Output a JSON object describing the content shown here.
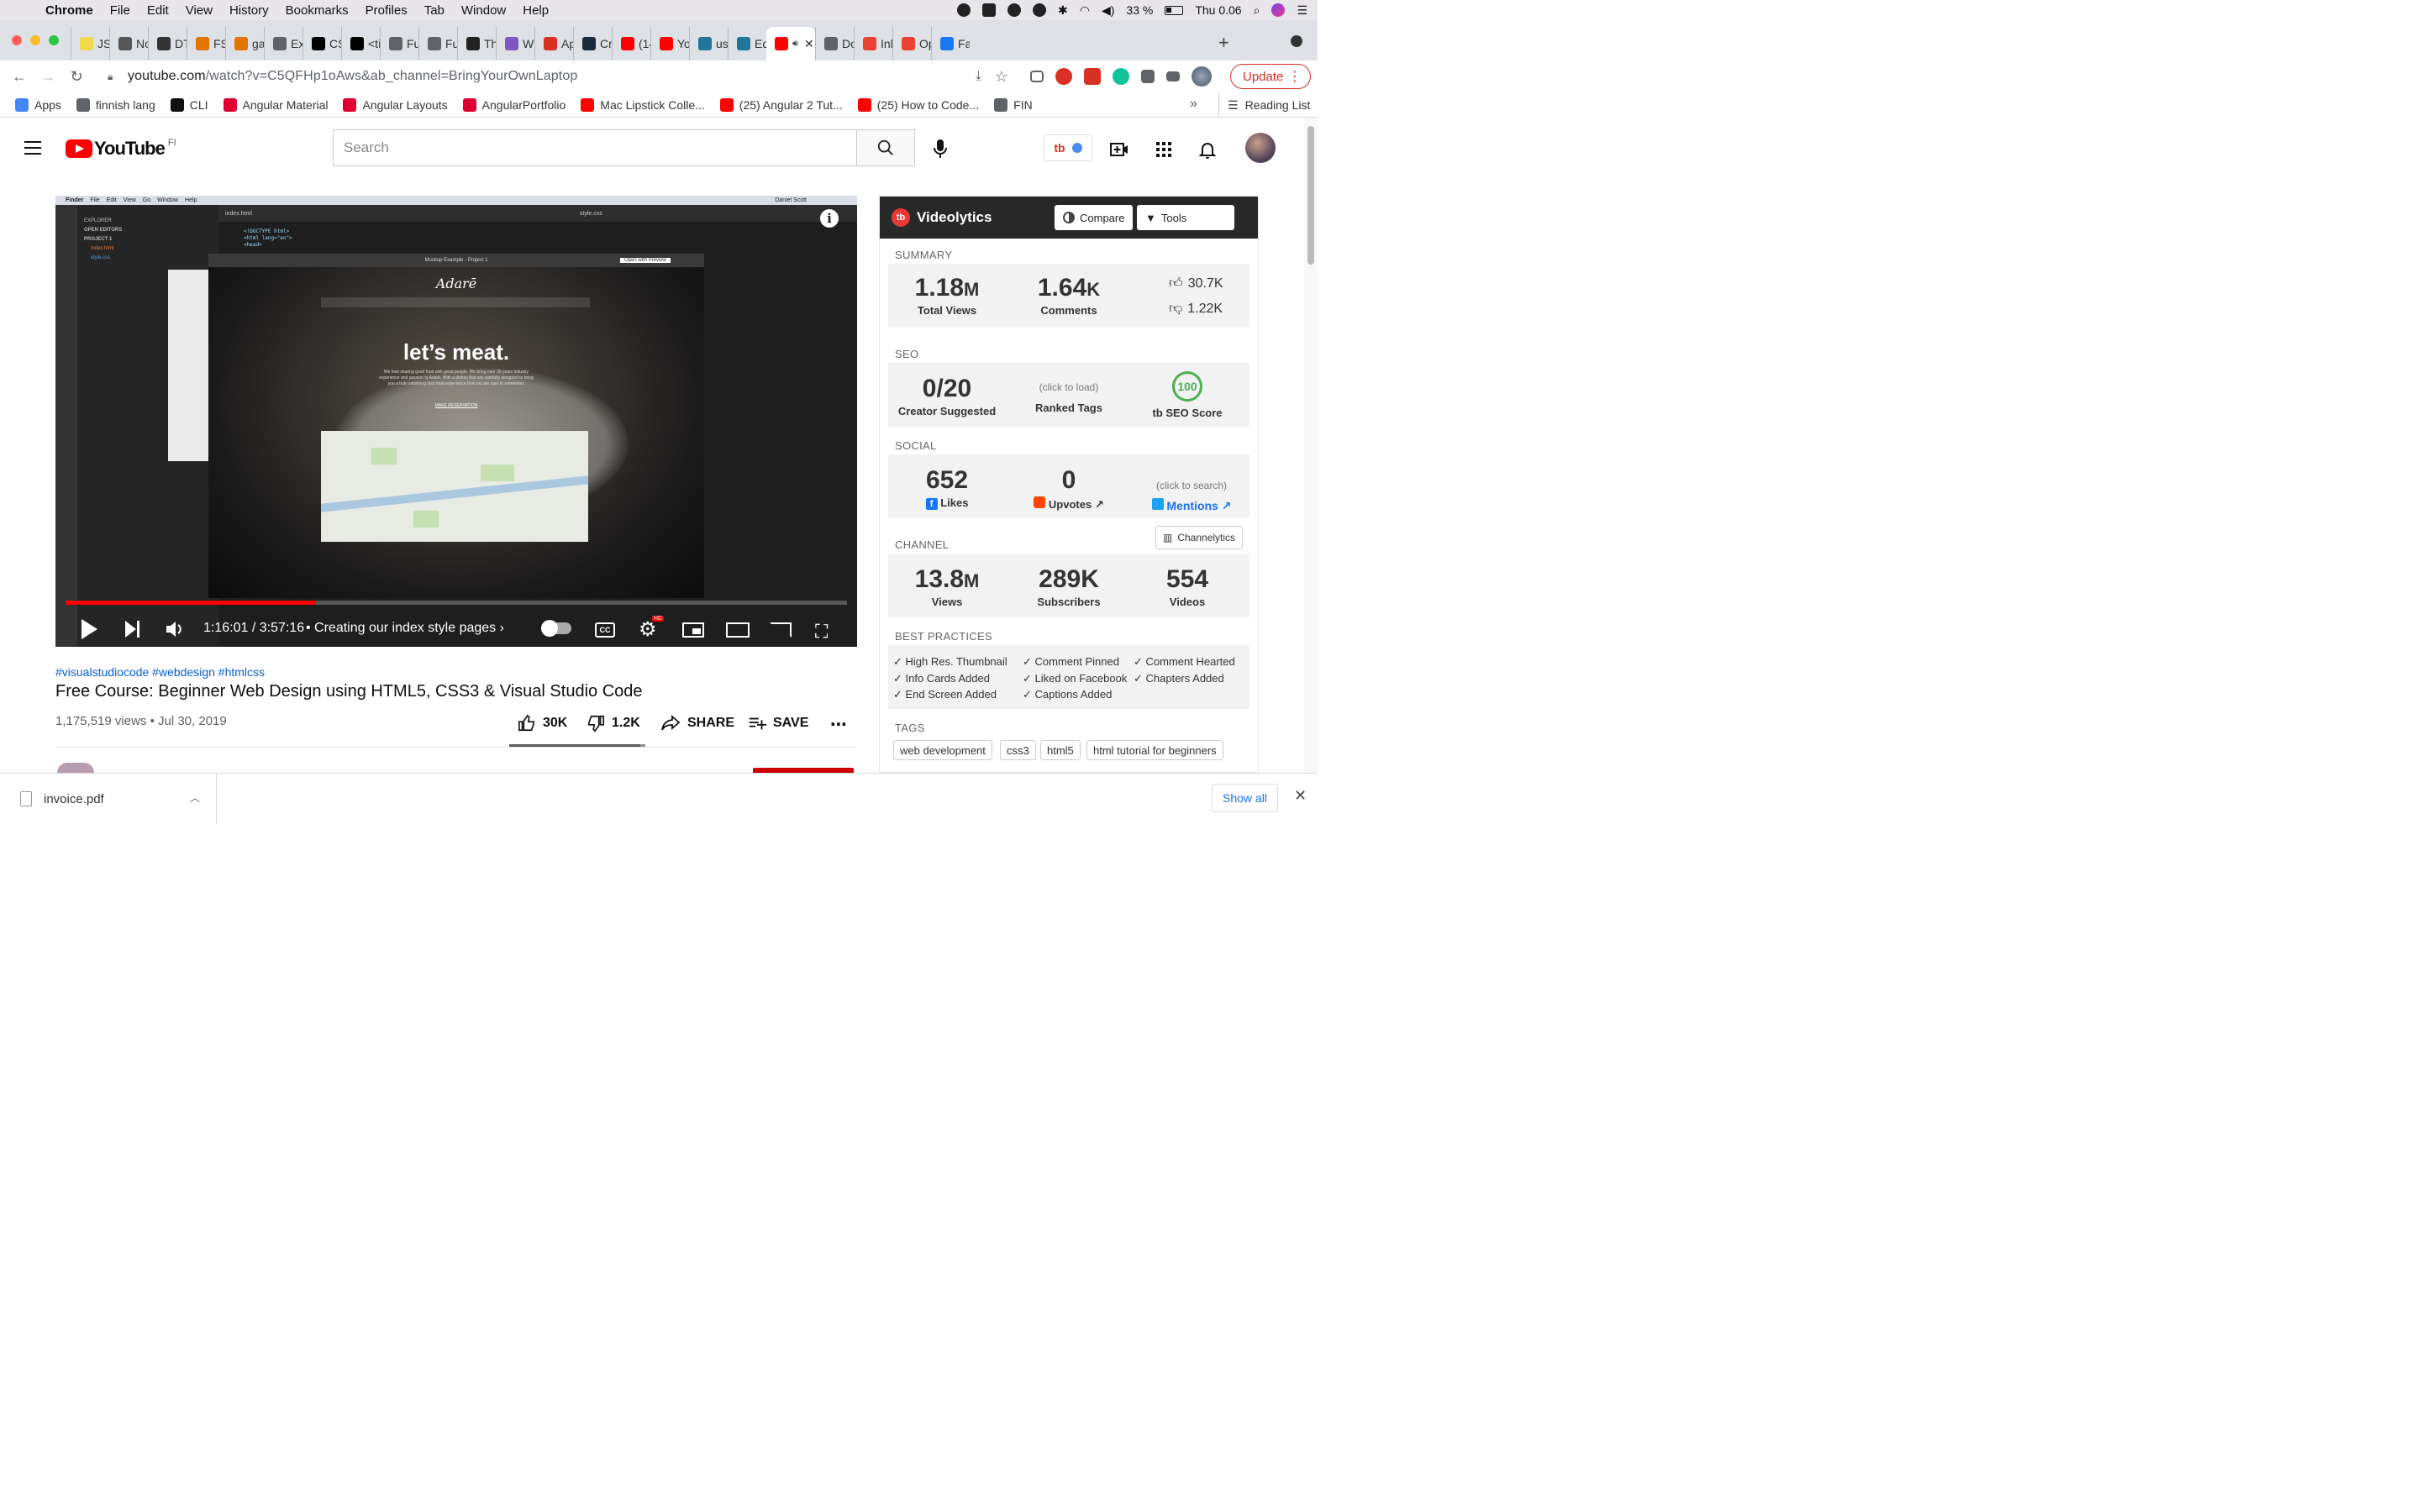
{
  "menubar": {
    "app": "Chrome",
    "items": [
      "File",
      "Edit",
      "View",
      "History",
      "Bookmarks",
      "Profiles",
      "Tab",
      "Window",
      "Help"
    ],
    "battery": "33 %",
    "clock": "Thu 0.06"
  },
  "tabs": [
    {
      "label": "JS",
      "color": "#f0db4f"
    },
    {
      "label": "No",
      "color": "#555555"
    },
    {
      "label": "DT",
      "color": "#333333"
    },
    {
      "label": "FS",
      "color": "#e37400"
    },
    {
      "label": "ga",
      "color": "#e37400"
    },
    {
      "label": "Ex",
      "color": "#5f6368"
    },
    {
      "label": "CS",
      "color": "#000000"
    },
    {
      "label": "<ti",
      "color": "#000000"
    },
    {
      "label": "Fu",
      "color": "#5f6368"
    },
    {
      "label": "Fu",
      "color": "#5f6368"
    },
    {
      "label": "Th",
      "color": "#222222"
    },
    {
      "label": "W",
      "color": "#7e57c2"
    },
    {
      "label": "Ap",
      "color": "#d93025"
    },
    {
      "label": "Cr",
      "color": "#1a2a3a"
    },
    {
      "label": "(14",
      "color": "#ff0000"
    },
    {
      "label": "Yo",
      "color": "#ff0000"
    },
    {
      "label": "us",
      "color": "#21759b"
    },
    {
      "label": "Ed",
      "color": "#21759b"
    },
    {
      "label": "Do",
      "color": "#5f6368"
    },
    {
      "label": "Inl",
      "color": "#ea4335"
    },
    {
      "label": "Op",
      "color": "#ea4335"
    },
    {
      "label": "Fa",
      "color": "#1877f2"
    }
  ],
  "address": {
    "host": "youtube.com",
    "path": "/watch?v=C5QFHp1oAws&ab_channel=BringYourOwnLaptop"
  },
  "update_label": "Update",
  "bookmarks": [
    {
      "label": "Apps",
      "color": "#4285f4"
    },
    {
      "label": "finnish lang",
      "color": "#5f6368"
    },
    {
      "label": "CLI",
      "color": "#111111"
    },
    {
      "label": "Angular Material",
      "color": "#dd0031"
    },
    {
      "label": "Angular Layouts",
      "color": "#dd0031"
    },
    {
      "label": "AngularPortfolio",
      "color": "#dd0031"
    },
    {
      "label": "Mac Lipstick Colle...",
      "color": "#ff0000"
    },
    {
      "label": "(25) Angular 2 Tut...",
      "color": "#ff0000"
    },
    {
      "label": "(25) How to Code...",
      "color": "#ff0000"
    },
    {
      "label": "FIN",
      "color": "#5f6368"
    }
  ],
  "reading_list": "Reading List",
  "youtube": {
    "logo_word": "YouTube",
    "country": "FI",
    "search_placeholder": "Search"
  },
  "player": {
    "vs_menu": [
      "Finder",
      "File",
      "Edit",
      "View",
      "Go",
      "Window",
      "Help"
    ],
    "vs_user": "Daniel Scott",
    "explorer_title": "EXPLORER",
    "open_editors": "OPEN EDITORS",
    "project": "PROJECT 1",
    "files": [
      "index.html",
      "style.css"
    ],
    "editor_tab": "index.html",
    "css_tab": "style.css",
    "code_lines": [
      "<!DOCTYPE html>",
      "<html lang=\"en\">",
      "<head>"
    ],
    "mockup_title": "Mockup Example - Project 1",
    "open_preview": "Open with Preview",
    "restaurant": "Adarē",
    "headline": "let’s meat.",
    "subtext": "We love sharing good food with great people. We bring over 30 years industry experience and passion to Adarē. With a dishes that are carefully designed to bring you a truly satisfying Irish food experience that you are sure to remember.",
    "reservation": "MAKE RESERVATION",
    "time_current": "1:16:01",
    "time_total": "3:57:16",
    "chapter": "Creating our index style pages",
    "progress_fraction": 0.32,
    "hd_badge": "HD"
  },
  "video": {
    "hashtags": "#visualstudiocode #webdesign #htmlcss",
    "title": "Free Course: Beginner Web Design using HTML5, CSS3 & Visual Studio Code",
    "views_date": "1,175,519 views • Jul 30, 2019",
    "likes": "30K",
    "dislikes": "1.2K",
    "share": "SHARE",
    "save": "SAVE",
    "like_ratio": 0.96
  },
  "videolytics": {
    "title": "Videolytics",
    "compare": "Compare",
    "tools": "Tools",
    "summary": {
      "label": "SUMMARY",
      "views": "1.18",
      "views_unit": "M",
      "views_label": "Total Views",
      "comments": "1.64",
      "comments_unit": "K",
      "comments_label": "Comments",
      "likes": "30.7K",
      "dislikes": "1.22K"
    },
    "seo": {
      "label": "SEO",
      "creator": "0/20",
      "creator_label": "Creator Suggested",
      "ranked_hint": "(click to load)",
      "ranked_label": "Ranked Tags",
      "score": "100",
      "score_label": "SEO Score"
    },
    "social": {
      "label": "SOCIAL",
      "likes": "652",
      "likes_label": "Likes",
      "upvotes": "0",
      "upvotes_label": "Upvotes",
      "mentions_hint": "(click to search)",
      "mentions_label": "Mentions"
    },
    "channel": {
      "label": "CHANNEL",
      "button": "Channelytics",
      "views": "13.8",
      "views_unit": "M",
      "views_label": "Views",
      "subs": "289K",
      "subs_label": "Subscribers",
      "videos": "554",
      "videos_label": "Videos"
    },
    "best_practices": {
      "label": "BEST PRACTICES",
      "items": [
        "✓ High Res. Thumbnail",
        "✓ Comment Pinned",
        "✓ Comment Hearted",
        "✓ Info Cards Added",
        "✓ Liked on Facebook",
        "✓ Chapters Added",
        "✓ End Screen Added",
        "✓ Captions Added"
      ]
    },
    "tags": {
      "label": "TAGS",
      "items": [
        "web development",
        "css3",
        "html5",
        "html tutorial for beginners"
      ]
    }
  },
  "downloads": {
    "file": "invoice.pdf",
    "show_all": "Show all"
  }
}
